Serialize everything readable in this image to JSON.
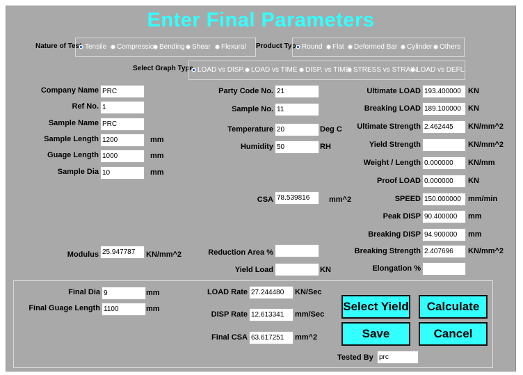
{
  "title": "Enter Final Parameters",
  "nature_of_test": {
    "label": "Nature of Test",
    "options": [
      "Tensile",
      "Compression",
      "Bending",
      "Shear",
      "Flexural"
    ],
    "selected": "Tensile"
  },
  "product_type": {
    "label": "Product Type",
    "options": [
      "Round",
      "Flat",
      "Deformed Bar",
      "Cylinder",
      "Others"
    ],
    "selected": "Round"
  },
  "graph_type": {
    "label": "Select Graph Type",
    "options": [
      "LOAD vs DISP.",
      "LOAD vs TIME",
      "DISP. vs TIME",
      "STRESS vs STRAIN",
      "LOAD vs DEFL."
    ],
    "selected": "LOAD vs DISP."
  },
  "left_fields": {
    "company_name": {
      "label": "Company Name",
      "value": "PRC"
    },
    "ref_no": {
      "label": "Ref No.",
      "value": "1"
    },
    "sample_name": {
      "label": "Sample Name",
      "value": "PRC"
    },
    "sample_length": {
      "label": "Sample Length",
      "value": "1200",
      "unit": "mm"
    },
    "guage_length": {
      "label": "Guage Length",
      "value": "1000",
      "unit": "mm"
    },
    "sample_dia": {
      "label": "Sample Dia",
      "value": "10",
      "unit": "mm"
    },
    "modulus": {
      "label": "Modulus",
      "value": "25.947787",
      "unit": "KN/mm^2"
    }
  },
  "mid_fields": {
    "party_code": {
      "label": "Party Code No.",
      "value": "21"
    },
    "sample_no": {
      "label": "Sample No.",
      "value": "11"
    },
    "temperature": {
      "label": "Temperature",
      "value": "20",
      "unit": "Deg C"
    },
    "humidity": {
      "label": "Humidity",
      "value": "50",
      "unit": "RH"
    },
    "csa": {
      "label": "CSA",
      "value": "78.539816",
      "unit": "mm^2"
    },
    "reduction_area": {
      "label": "Reduction Area %",
      "value": ""
    },
    "yield_load": {
      "label": "Yield Load",
      "value": "",
      "unit": "KN"
    }
  },
  "right_fields": {
    "ultimate_load": {
      "label": "Ultimate LOAD",
      "value": "193.400000",
      "unit": "KN"
    },
    "breaking_load": {
      "label": "Breaking LOAD",
      "value": "189.100000",
      "unit": "KN"
    },
    "ultimate_strength": {
      "label": "Ultimate Strength",
      "value": "2.462445",
      "unit": "KN/mm^2"
    },
    "yield_strength": {
      "label": "Yield Strength",
      "value": "",
      "unit": "KN/mm^2"
    },
    "weight_length": {
      "label": "Weight / Length",
      "value": "0.000000",
      "unit": "KN/mm"
    },
    "proof_load": {
      "label": "Proof LOAD",
      "value": "0.000000",
      "unit": "KN"
    },
    "speed": {
      "label": "SPEED",
      "value": "150.000000",
      "unit": "mm/min"
    },
    "peak_disp": {
      "label": "Peak DISP",
      "value": "90.400000",
      "unit": "mm"
    },
    "breaking_disp": {
      "label": "Breaking DISP",
      "value": "94.900000",
      "unit": "mm"
    },
    "breaking_strength": {
      "label": "Breaking Strength",
      "value": "2.407696",
      "unit": "KN/mm^2"
    },
    "elongation": {
      "label": "Elongation %",
      "value": ""
    }
  },
  "bottom": {
    "final_dia": {
      "label": "Final Dia",
      "value": "9",
      "unit": "mm"
    },
    "final_guage_length": {
      "label": "Final Guage Length",
      "value": "1100",
      "unit": "mm"
    },
    "load_rate": {
      "label": "LOAD Rate",
      "value": "27.244480",
      "unit": "KN/Sec"
    },
    "disp_rate": {
      "label": "DISP Rate",
      "value": "12.613341",
      "unit": "mm/Sec"
    },
    "final_csa": {
      "label": "Final CSA",
      "value": "63.617251",
      "unit": "mm^2"
    },
    "tested_by": {
      "label": "Tested By",
      "value": "prc"
    }
  },
  "buttons": {
    "select_yield": "Select Yield",
    "calculate": "Calculate",
    "save": "Save",
    "cancel": "Cancel"
  },
  "colors": {
    "accent": "#33ffff",
    "panel": "#a9a9a9",
    "radio_selected": "#1a5cc4"
  }
}
